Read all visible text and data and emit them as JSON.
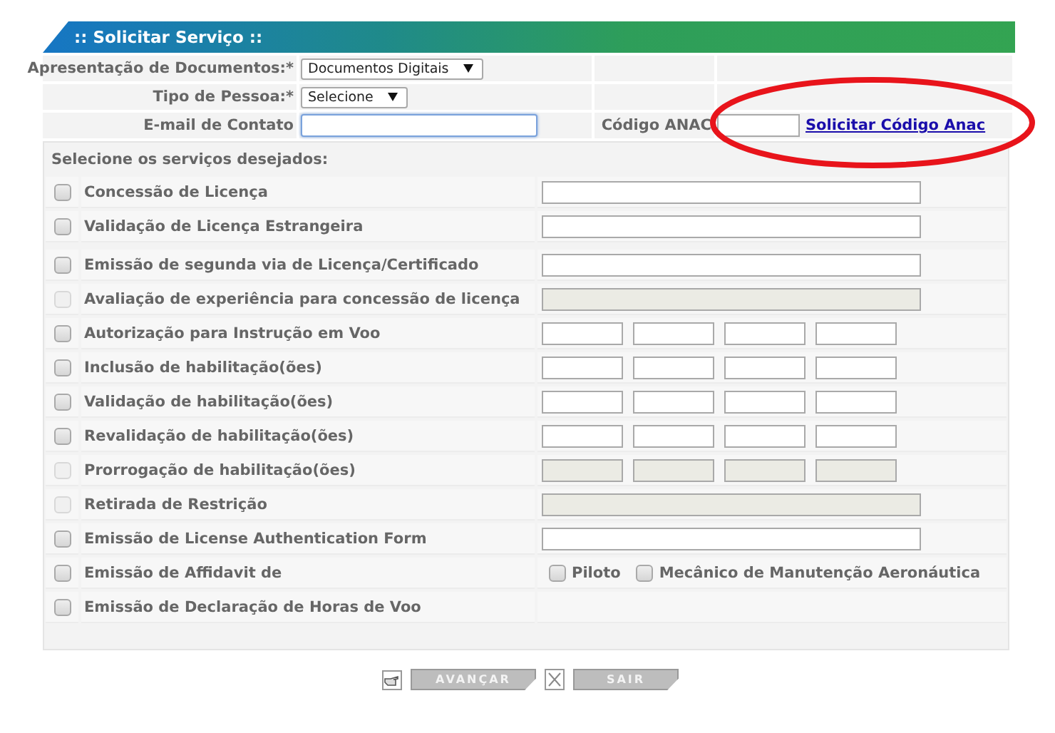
{
  "header": {
    "title": ":: Solicitar Serviço ::"
  },
  "fields": [
    {
      "label": "Apresentação de Documentos:*",
      "kind": "select",
      "value": "Documentos Digitais",
      "focused": false
    },
    {
      "label": "Tipo de Pessoa:*",
      "kind": "select",
      "value": "Selecione",
      "focused": false
    },
    {
      "label": "E-mail de Contato",
      "kind": "input",
      "focused": true
    }
  ],
  "anac": {
    "label": "Código ANAC",
    "link": "Solicitar Código Anac"
  },
  "services": {
    "heading": "Selecione os serviços desejados:",
    "groups": [
      [
        {
          "label": "Concessão de Licença",
          "kind": "text",
          "disabled": false,
          "checked": false
        },
        {
          "label": "Validação de Licença Estrangeira",
          "kind": "text",
          "disabled": false,
          "checked": false
        }
      ],
      [
        {
          "label": "Emissão de segunda via de Licença/Certificado",
          "kind": "text",
          "disabled": false,
          "checked": false
        },
        {
          "label": "Avaliação de experiência para concessão de licença",
          "kind": "text",
          "disabled": true,
          "checked": false
        },
        {
          "label": "Autorização para Instrução em Voo",
          "kind": "quad",
          "disabled": false,
          "checked": false
        },
        {
          "label": "Inclusão de habilitação(ões)",
          "kind": "quad",
          "disabled": false,
          "checked": false
        },
        {
          "label": "Validação de habilitação(ões)",
          "kind": "quad",
          "disabled": false,
          "checked": false
        },
        {
          "label": "Revalidação de habilitação(ões)",
          "kind": "quad",
          "disabled": false,
          "checked": false
        },
        {
          "label": "Prorrogação de habilitação(ões)",
          "kind": "quad",
          "disabled": true,
          "checked": false
        },
        {
          "label": "Retirada de Restrição",
          "kind": "text",
          "disabled": true,
          "checked": false
        },
        {
          "label": "Emissão de License Authentication Form",
          "kind": "text",
          "disabled": false,
          "checked": false
        },
        {
          "label": "Emissão de Affidavit de",
          "kind": "options",
          "disabled": false,
          "checked": false,
          "options": [
            {
              "label": "Piloto",
              "checked": false
            },
            {
              "label": "Mecânico de Manutenção Aeronáutica",
              "checked": false
            }
          ]
        },
        {
          "label": "Emissão de Declaração de Horas de Voo",
          "kind": "none",
          "disabled": false,
          "checked": false
        }
      ]
    ]
  },
  "buttons": [
    {
      "label": "AVANÇAR",
      "kind": "next"
    },
    {
      "label": "SAIR",
      "kind": "exit"
    }
  ]
}
